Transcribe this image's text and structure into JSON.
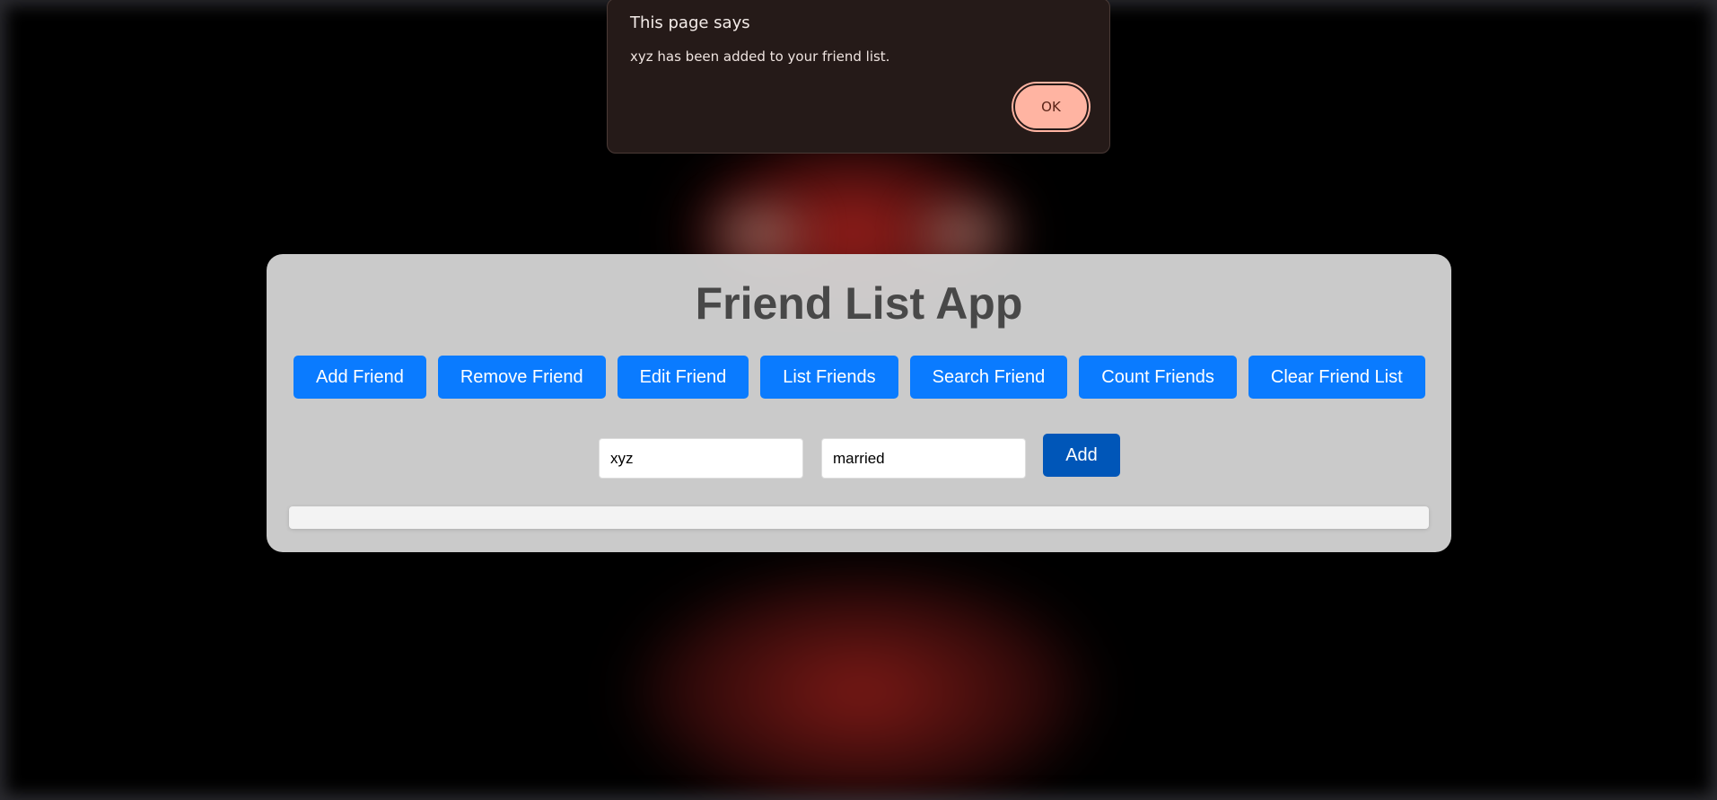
{
  "app": {
    "title": "Friend List App"
  },
  "toolbar": {
    "add_friend": "Add Friend",
    "remove_friend": "Remove Friend",
    "edit_friend": "Edit Friend",
    "list_friends": "List Friends",
    "search_friend": "Search Friend",
    "count_friends": "Count Friends",
    "clear_friend_list": "Clear Friend List"
  },
  "form": {
    "name_value": "xyz",
    "status_value": "married",
    "add_label": "Add"
  },
  "dialog": {
    "title": "This page says",
    "message": "xyz has been added to your friend list.",
    "ok_label": "OK"
  },
  "colors": {
    "primary_button": "#0a7bff",
    "add_button": "#0056b8",
    "dialog_background": "#251a18",
    "dialog_ok": "#ffb4a2"
  }
}
